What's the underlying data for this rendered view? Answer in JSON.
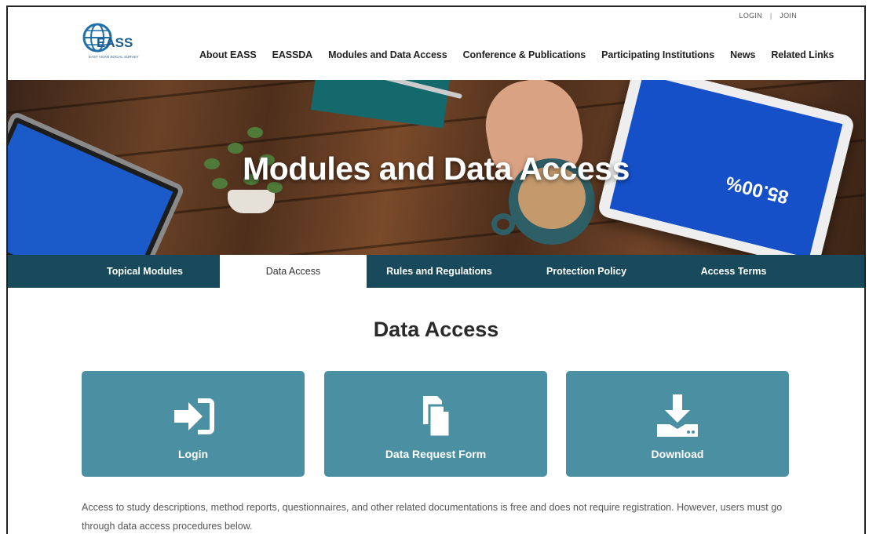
{
  "logo": {
    "text": "EASS",
    "subtext": "EAST ASIAN SOCIAL SURVEY"
  },
  "util": {
    "login": "LOGIN",
    "separator": "|",
    "join": "JOIN"
  },
  "nav": [
    {
      "label": "About EASS"
    },
    {
      "label": "EASSDA"
    },
    {
      "label": "Modules and Data Access"
    },
    {
      "label": "Conference & Publications"
    },
    {
      "label": "Participating Institutions"
    },
    {
      "label": "News"
    },
    {
      "label": "Related Links"
    }
  ],
  "hero": {
    "title": "Modules and Data Access",
    "tablet_text": "85.00%"
  },
  "subnav": [
    {
      "label": "Topical Modules"
    },
    {
      "label": "Data Access"
    },
    {
      "label": "Rules and Regulations"
    },
    {
      "label": "Protection Policy"
    },
    {
      "label": "Access Terms"
    }
  ],
  "section": {
    "title": "Data Access"
  },
  "cards": [
    {
      "label": "Login",
      "icon": "login-icon"
    },
    {
      "label": "Data Request Form",
      "icon": "documents-icon"
    },
    {
      "label": "Download",
      "icon": "download-icon"
    }
  ],
  "description": "Access to study descriptions, method reports, questionnaires, and other related documentations is free and does not require registration. However, users must go through data access procedures below.",
  "colors": {
    "teal_card": "#4b90a2",
    "subnav_bg": "#184a5b",
    "logo_blue": "#1f5c8c"
  }
}
